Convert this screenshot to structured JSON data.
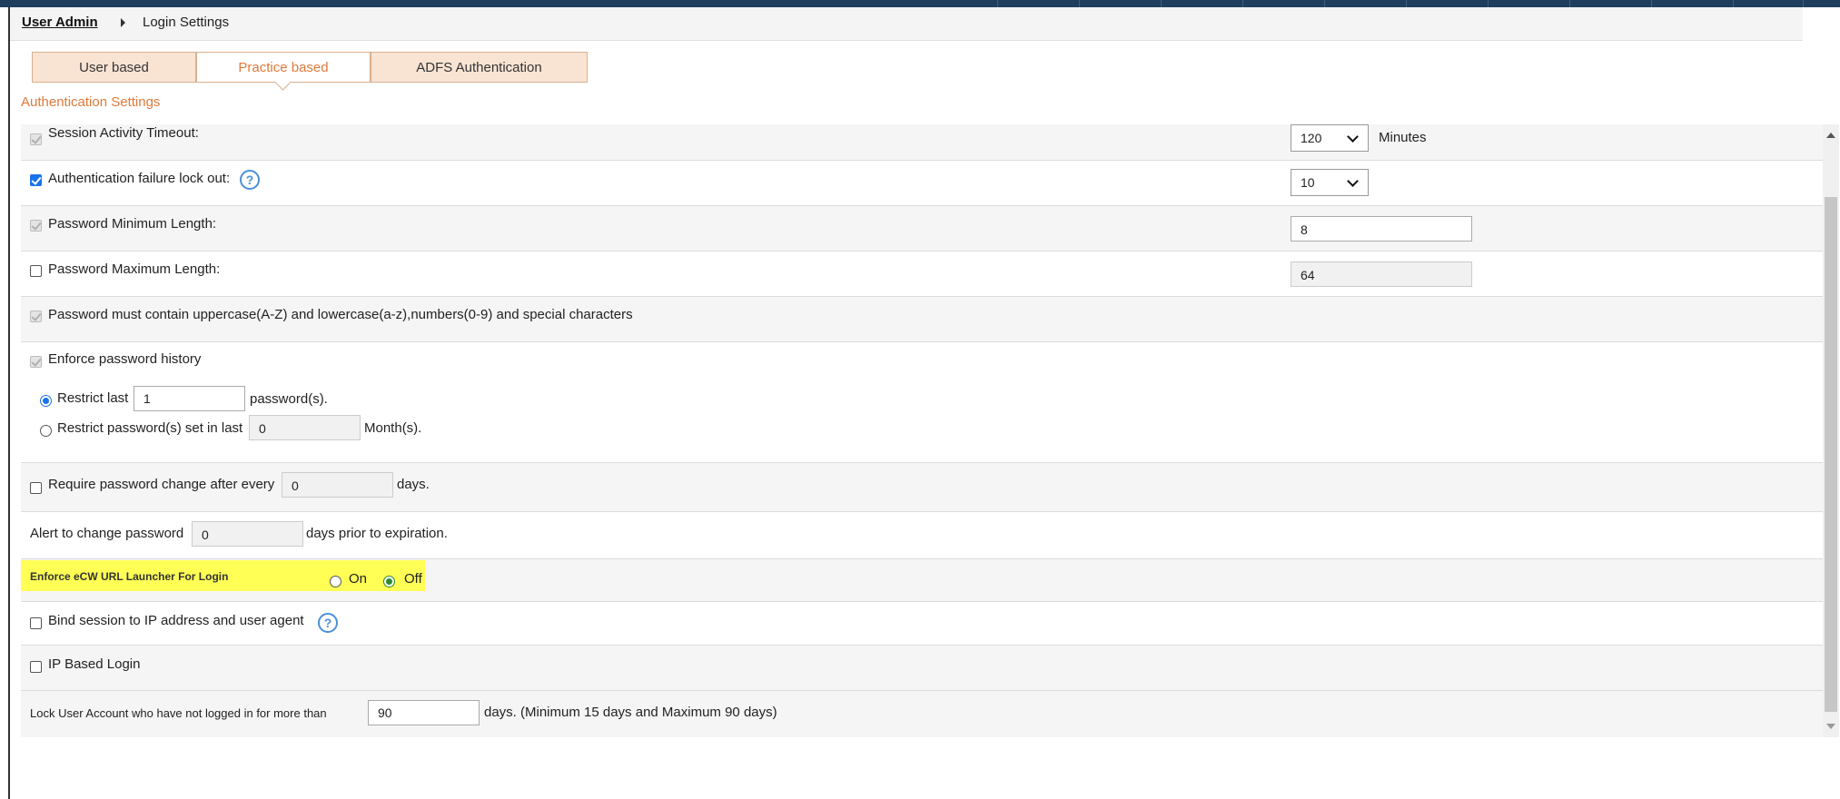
{
  "breadcrumb": {
    "parent": "User Admin",
    "current": "Login Settings"
  },
  "tabs": [
    {
      "label": "User based"
    },
    {
      "label": "Practice based"
    },
    {
      "label": "ADFS Authentication"
    }
  ],
  "active_tab": "Practice based",
  "section_title": "Authentication Settings",
  "settings": {
    "session_timeout": {
      "label": "Session Activity Timeout:",
      "value": "120",
      "unit": "Minutes"
    },
    "auth_lockout": {
      "label": "Authentication failure lock out:",
      "value": "10",
      "help": "?"
    },
    "pw_min_length": {
      "label": "Password Minimum Length:",
      "value": "8"
    },
    "pw_max_length": {
      "label": "Password Maximum Length:",
      "value": "64"
    },
    "pw_complexity": {
      "label": "Password must contain uppercase(A-Z) and lowercase(a-z),numbers(0-9) and special characters"
    },
    "pw_history": {
      "label": "Enforce password history",
      "restrict_last_label": "Restrict last",
      "restrict_last_value": "1",
      "restrict_last_suffix": "password(s).",
      "restrict_months_label": "Restrict password(s) set in last",
      "restrict_months_value": "0",
      "restrict_months_suffix": "Month(s)."
    },
    "pw_change": {
      "label": "Require password change after every",
      "value": "0",
      "suffix": "days."
    },
    "pw_alert": {
      "label": "Alert to change password",
      "value": "0",
      "suffix": "days prior to expiration."
    },
    "url_launcher": {
      "label": "Enforce eCW URL Launcher For Login",
      "on_label": "On",
      "off_label": "Off",
      "selected": "Off"
    },
    "bind_session": {
      "label": "Bind session to IP address and user agent",
      "help": "?"
    },
    "ip_login": {
      "label": "IP Based Login"
    },
    "lock_account": {
      "label": "Lock User Account who have not logged in for more than",
      "value": "90",
      "suffix": "days. (Minimum 15 days and Maximum 90 days)"
    }
  },
  "colors": {
    "accent": "#e07a3a",
    "tab_bg": "#f9e4d4",
    "highlight": "#ffff55",
    "checkbox_blue": "#1a73e8",
    "topbar": "#1e3e5e"
  }
}
